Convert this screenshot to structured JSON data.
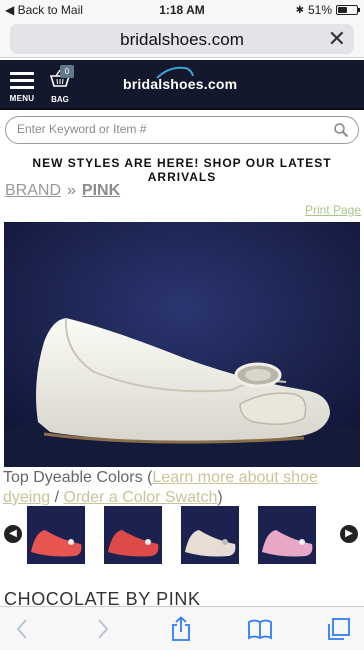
{
  "status_bar": {
    "back_label": "Back to Mail",
    "time": "1:18 AM",
    "battery_text": "51%",
    "battery_level": 0.51
  },
  "browser": {
    "url": "bridalshoes.com"
  },
  "header": {
    "menu_label": "MENU",
    "bag_label": "BAG",
    "bag_count": "0",
    "logo_text": "bridalshoes.com"
  },
  "search": {
    "placeholder": "Enter Keyword or Item #"
  },
  "promo_text": "NEW STYLES ARE HERE! SHOP OUR LATEST ARRIVALS",
  "breadcrumb": {
    "brand": "BRAND",
    "separator": "»",
    "current": "PINK"
  },
  "print_label": "Print Page",
  "colors": {
    "lead": "Top Dyeable Colors (",
    "learn_link": "Learn more about shoe dyeing",
    "divider": " / ",
    "order_link": "Order a Color Swatch",
    "tail": ")"
  },
  "swatches": [
    {
      "name": "coral",
      "color": "#e8544f"
    },
    {
      "name": "red-coral",
      "color": "#dd4a48"
    },
    {
      "name": "ivory",
      "color": "#e9dcd5"
    },
    {
      "name": "pink",
      "color": "#e9a7c8"
    }
  ],
  "product_title": "CHOCOLATE BY PINK",
  "colors_palette": {
    "header_bg": "#14182c",
    "link_green": "#a9c58b",
    "link_tan": "#c9c39a"
  }
}
